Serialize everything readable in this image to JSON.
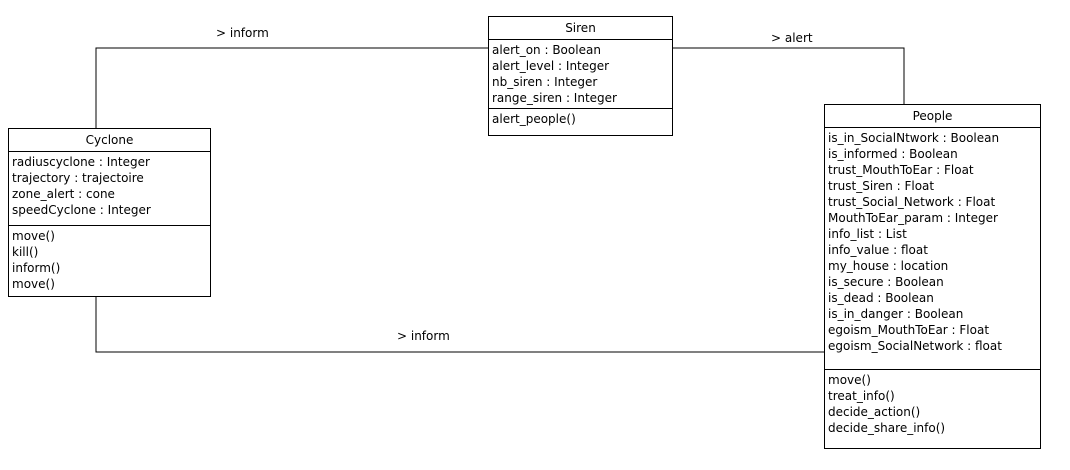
{
  "classes": {
    "siren": {
      "name": "Siren",
      "attributes": [
        "alert_on : Boolean",
        "alert_level : Integer",
        "nb_siren : Integer",
        "range_siren : Integer"
      ],
      "operations": [
        "alert_people()"
      ]
    },
    "cyclone": {
      "name": "Cyclone",
      "attributes": [
        "radiuscyclone : Integer",
        "trajectory : trajectoire",
        "zone_alert : cone",
        "speedCyclone : Integer"
      ],
      "operations": [
        "move()",
        "kill()",
        "inform()",
        "move()"
      ]
    },
    "people": {
      "name": "People",
      "attributes": [
        "is_in_SocialNtwork : Boolean",
        "is_informed : Boolean",
        "trust_MouthToEar : Float",
        "trust_Siren : Float",
        "trust_Social_Network : Float",
        "MouthToEar_param : Integer",
        "info_list : List",
        "info_value : float",
        "my_house : location",
        "is_secure : Boolean",
        "is_dead : Boolean",
        "is_in_danger : Boolean",
        "egoism_MouthToEar : Float",
        "egoism_SocialNetwork : float"
      ],
      "operations": [
        "move()",
        "treat_info()",
        "decide_action()",
        "decide_share_info()"
      ]
    }
  },
  "associations": {
    "cyclone_siren": "> inform",
    "siren_people": "> alert",
    "cyclone_people": "> inform"
  }
}
